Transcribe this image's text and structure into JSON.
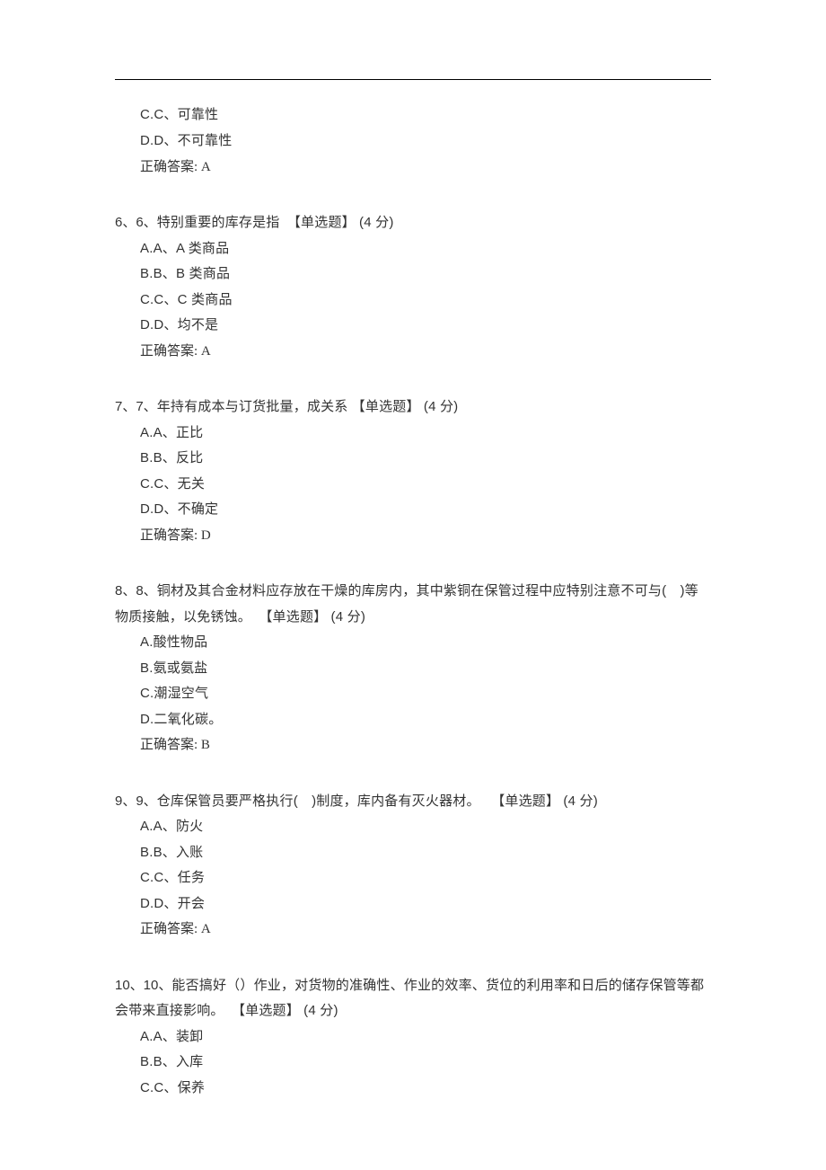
{
  "labels": {
    "correct_answer_prefix": "正确答案:",
    "type_tag": "【单选题】",
    "points_prefix": "(",
    "points_suffix": " 分)"
  },
  "page_head_continuation": {
    "options": [
      {
        "prefix": "C.C、",
        "text": "可靠性"
      },
      {
        "prefix": "D.D、",
        "text": "不可靠性"
      }
    ],
    "correct_answer": "A"
  },
  "questions": [
    {
      "number": "6、6、",
      "stem": "特别重要的库存是指",
      "type_tag": "【单选题】",
      "points": "4",
      "options": [
        {
          "prefix": "A.A、",
          "text": "A 类商品"
        },
        {
          "prefix": "B.B、",
          "text": "B 类商品"
        },
        {
          "prefix": "C.C、",
          "text": "C 类商品"
        },
        {
          "prefix": "D.D、",
          "text": "均不是"
        }
      ],
      "correct_answer": "A"
    },
    {
      "number": "7、7、",
      "stem": "年持有成本与订货批量，成关系",
      "type_tag": "【单选题】",
      "points": "4",
      "options": [
        {
          "prefix": "A.A、",
          "text": "正比"
        },
        {
          "prefix": "B.B、",
          "text": "反比"
        },
        {
          "prefix": "C.C、",
          "text": "无关"
        },
        {
          "prefix": "D.D、",
          "text": "不确定"
        }
      ],
      "correct_answer": "D"
    },
    {
      "number": "8、8、",
      "stem": "铜材及其合金材料应存放在干燥的库房内，其中紫铜在保管过程中应特别注意不可与( )等物质接触，以免锈蚀。",
      "type_tag": "【单选题】",
      "points": "4",
      "options": [
        {
          "prefix": "A.",
          "text": "酸性物品"
        },
        {
          "prefix": "B.",
          "text": "氨或氨盐"
        },
        {
          "prefix": "C.",
          "text": "潮湿空气"
        },
        {
          "prefix": "D.",
          "text": "二氧化碳。"
        }
      ],
      "correct_answer": "B"
    },
    {
      "number": "9、9、",
      "stem": "仓库保管员要严格执行( )制度，库内备有灭火器材。",
      "type_tag": "【单选题】",
      "points": "4",
      "options": [
        {
          "prefix": "A.A、",
          "text": "防火"
        },
        {
          "prefix": "B.B、",
          "text": "入账"
        },
        {
          "prefix": "C.C、",
          "text": "任务"
        },
        {
          "prefix": "D.D、",
          "text": "开会"
        }
      ],
      "correct_answer": "A"
    },
    {
      "number": "10、10、",
      "stem": "能否搞好（）作业，对货物的准确性、作业的效率、货位的利用率和日后的储存保管等都会带来直接影响。",
      "type_tag": "【单选题】",
      "points": "4",
      "options": [
        {
          "prefix": "A.A、",
          "text": "装卸"
        },
        {
          "prefix": "B.B、",
          "text": "入库"
        },
        {
          "prefix": "C.C、",
          "text": "保养"
        }
      ],
      "correct_answer": null
    }
  ]
}
